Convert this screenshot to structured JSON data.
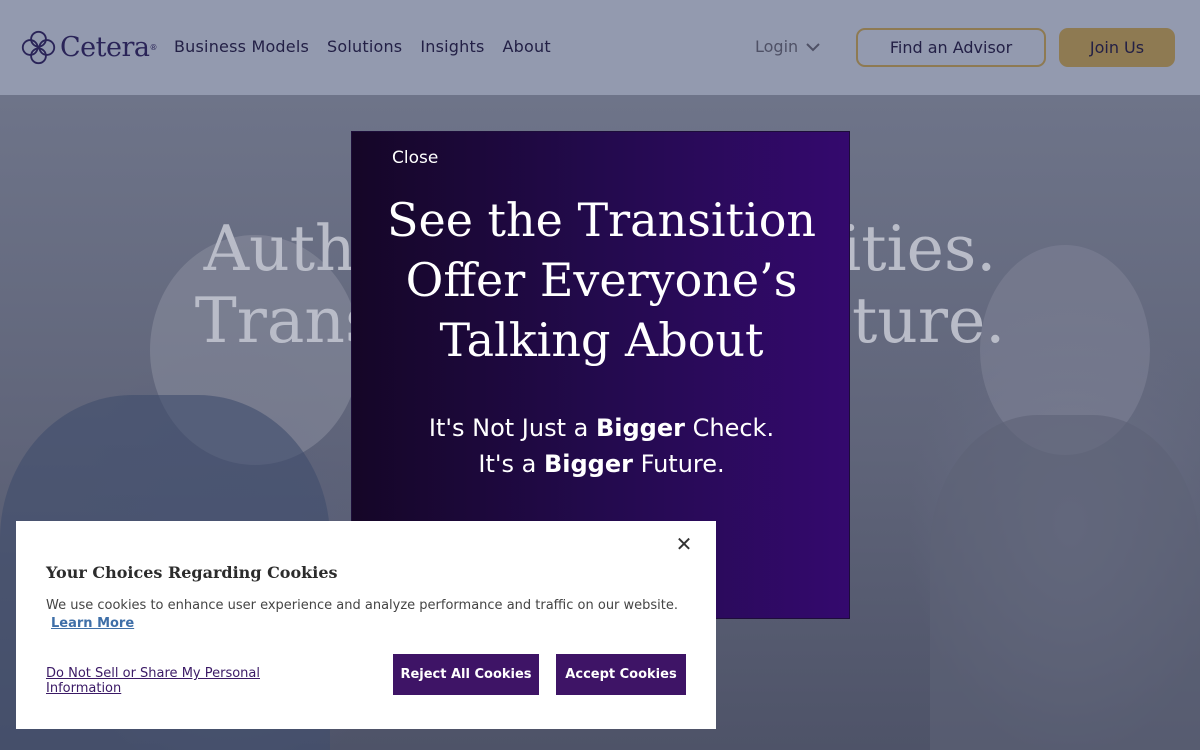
{
  "header": {
    "logo_text": "Cetera",
    "logo_reg": "®",
    "nav": [
      "Business Models",
      "Solutions",
      "Insights",
      "About"
    ],
    "login_label": "Login",
    "find_advisor_label": "Find an Advisor",
    "join_label": "Join Us"
  },
  "hero": {
    "title_line1": "Authentic Opportunities.",
    "title_line2": "Transformational Future."
  },
  "promo": {
    "close_label": "Close",
    "heading_line1": "See the Transition",
    "heading_line2": "Offer Everyone’s",
    "heading_line3": "Talking About",
    "sub_line1_pre": "It's Not Just a",
    "sub_line1_bold": "Bigger",
    "sub_line1_post": "Check.",
    "sub_line2_pre": "It's a",
    "sub_line2_bold": "Bigger",
    "sub_line2_post": "Future."
  },
  "cookie": {
    "close_glyph": "✕",
    "title": "Your Choices Regarding Cookies",
    "text": "We use cookies to enhance user experience and analyze performance and traffic on our website.",
    "learn_more": "Learn More",
    "dns_label": "Do Not Sell or Share My Personal Information",
    "reject_label": "Reject All Cookies",
    "accept_label": "Accept Cookies"
  },
  "colors": {
    "brand_navy": "#2a2458",
    "gold": "#8e7a52",
    "promo_purple": "#34096e",
    "cookie_button": "#3e1466"
  }
}
